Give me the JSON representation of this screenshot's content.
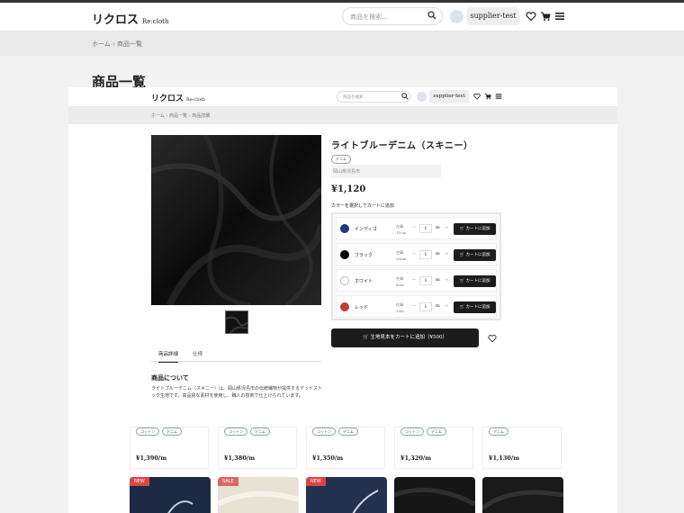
{
  "header": {
    "logo": "リクロス",
    "logo_sub": "Re:cloth",
    "search_placeholder": "商品を検索...",
    "user": "supplier-test"
  },
  "breadcrumb": [
    "ホーム",
    "商品一覧"
  ],
  "page_title": "商品一覧",
  "inner": {
    "logo": "リクロス",
    "logo_sub": "Re:cloth",
    "search_placeholder": "商品を検索...",
    "user": "supplier-test",
    "breadcrumb": [
      "ホーム",
      "商品一覧",
      "商品詳細"
    ]
  },
  "product": {
    "name": "ライトブルーデニム（スキニー）",
    "tag": "デニム",
    "origin": "岡山県児島市",
    "price": "¥1,120",
    "color_prompt": "カラーを選択してカートに追加",
    "colors": [
      {
        "name": "インディゴ",
        "stock_label": "在庫:",
        "stock": "110m",
        "qty": "1",
        "unit": "m",
        "color": "#1f3a7a"
      },
      {
        "name": "ブラック",
        "stock_label": "在庫:",
        "stock": "200m",
        "qty": "1",
        "unit": "m",
        "color": "#000000"
      },
      {
        "name": "ホワイト",
        "stock_label": "在庫:",
        "stock": "80m",
        "qty": "1",
        "unit": "m",
        "color": "#ffffff"
      },
      {
        "name": "レッド",
        "stock_label": "在庫:",
        "stock": "50m",
        "qty": "1",
        "unit": "m",
        "color": "#c73a34"
      }
    ],
    "cart_label": "カートに追加",
    "sample_label": "生地見本をカートに追加（¥500）",
    "tabs": [
      "商品詳細",
      "仕様"
    ],
    "desc_heading": "商品について",
    "description": "ライトブルーデニム（スキニー）は、岡山県児島市の伝統織物が提供するデッドストック生地です。高品質な素材を使用し、職人の技術で仕上げられています。"
  },
  "grid": [
    {
      "tags": [
        "コットン",
        "デニム"
      ],
      "price": "¥1,390/m"
    },
    {
      "tags": [
        "コットン",
        "デニム"
      ],
      "price": "¥1,380/m"
    },
    {
      "tags": [
        "コットン",
        "デニム"
      ],
      "price": "¥1,350/m"
    },
    {
      "tags": [
        "コットン",
        "デニム"
      ],
      "price": "¥1,320/m"
    },
    {
      "tags": [
        "デニム"
      ],
      "price": "¥1,130/m"
    }
  ],
  "bottom_cards": [
    {
      "badge": "NEW",
      "badge_type": "new",
      "fill": "#1d2a44"
    },
    {
      "badge": "SALE",
      "badge_type": "sale",
      "fill": "#e8e2d4"
    },
    {
      "badge": "NEW",
      "badge_type": "new",
      "fill": "#22324f"
    },
    {
      "badge": "",
      "badge_type": "",
      "fill": "#161616"
    },
    {
      "badge": "",
      "badge_type": "",
      "fill": "#1a1a1a"
    }
  ]
}
